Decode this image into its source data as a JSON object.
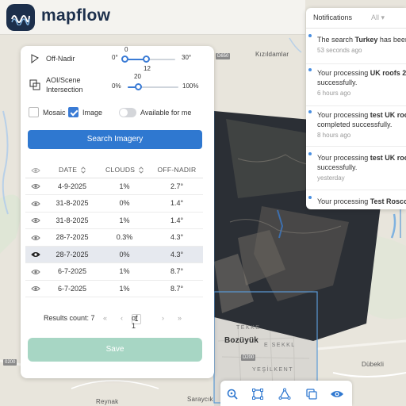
{
  "app": {
    "name": "mapflow"
  },
  "map": {
    "labels": {
      "kizildamlar": "Kızıldamlar",
      "bozuyuk": "Bozüyük",
      "tekke": "TEKKE",
      "eskel": "E SEKKL",
      "yesilkent": "YEŞİLKENT",
      "dubekli": "Dübekli",
      "saraycik": "Saraycık",
      "reynak": "Reynak",
      "road_d200": "D200",
      "road_d650": "D650",
      "road_0200": "0200"
    }
  },
  "search_panel": {
    "off_nadir": {
      "label": "Off-Nadir",
      "min_label": "0°",
      "max_label": "30°",
      "low_value": "0",
      "high_value": "12"
    },
    "aoi_intersection": {
      "label_line1": "AOI/Scene",
      "label_line2": "Intersection",
      "min_label": "0%",
      "max_label": "100%",
      "value": "20"
    },
    "filters": {
      "mosaic_label": "Mosaic",
      "mosaic_checked": false,
      "image_label": "Image",
      "image_checked": true,
      "available_label": "Available for me",
      "available_on": false
    },
    "search_button": "Search Imagery",
    "table": {
      "columns": {
        "date": "DATE",
        "clouds": "CLOUDS",
        "off_nadir": "OFF-NADIR"
      },
      "rows": [
        {
          "date": "4-9-2025",
          "clouds": "1%",
          "off_nadir": "2.7°"
        },
        {
          "date": "31-8-2025",
          "clouds": "0%",
          "off_nadir": "1.4°"
        },
        {
          "date": "31-8-2025",
          "clouds": "1%",
          "off_nadir": "1.4°"
        },
        {
          "date": "28-7-2025",
          "clouds": "0.3%",
          "off_nadir": "4.3°"
        },
        {
          "date": "28-7-2025",
          "clouds": "0%",
          "off_nadir": "4.3°"
        },
        {
          "date": "6-7-2025",
          "clouds": "1%",
          "off_nadir": "8.7°"
        },
        {
          "date": "6-7-2025",
          "clouds": "1%",
          "off_nadir": "8.7°"
        }
      ],
      "selected_row": 4
    },
    "pagination": {
      "results_label": "Results count: 7",
      "page": "1",
      "of_label": "of 1"
    },
    "save_button": "Save"
  },
  "notifications": {
    "title": "Notifications",
    "filter": "All",
    "items": [
      {
        "pre": "The search ",
        "bold": "Turkey",
        "post": " has been",
        "line2": "",
        "time": "53 seconds ago"
      },
      {
        "pre": "Your processing ",
        "bold": "UK roofs 2",
        "post": "",
        "line2": "successfully.",
        "time": "6 hours ago"
      },
      {
        "pre": "Your processing ",
        "bold": "test UK roo",
        "post": "",
        "line2": "completed successfully.",
        "time": "8 hours ago"
      },
      {
        "pre": "Your processing ",
        "bold": "test UK roo",
        "post": "",
        "line2": "successfully.",
        "time": "yesterday"
      },
      {
        "pre": "Your processing ",
        "bold": "Test Roscos",
        "post": "",
        "line2": "",
        "time": ""
      }
    ]
  },
  "colors": {
    "primary": "#2f78d0",
    "save_disabled": "#a7d6c4",
    "brand_dark": "#1c2f4b",
    "selected_row": "#e6e9ef"
  },
  "toolbar": {
    "icons": [
      "search-zoom-icon",
      "polygon-select-icon",
      "draw-vector-icon",
      "layers-icon",
      "eye-icon"
    ]
  }
}
